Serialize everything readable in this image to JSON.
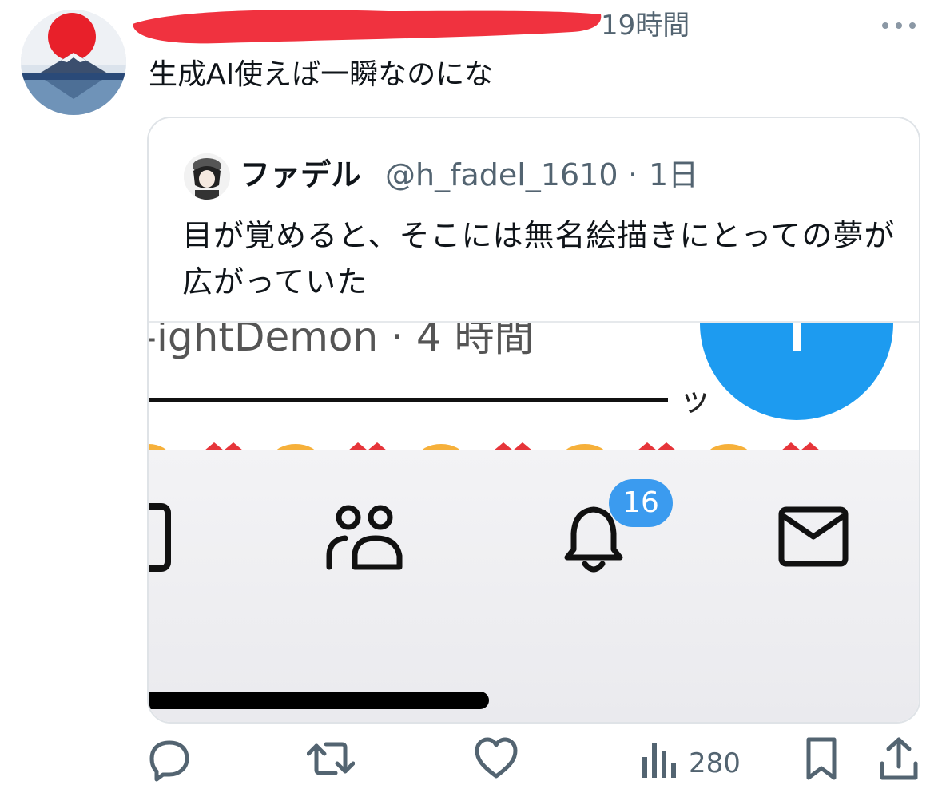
{
  "tweet": {
    "timestamp": "19時間",
    "text": "生成AI使えば一瞬なのにな",
    "more_icon": "more-dots-icon"
  },
  "quote": {
    "display_name": "ファデル",
    "handle": "@h_fadel_1610",
    "separator": "·",
    "time": "1日",
    "text": "目が覚めると、そこには無名絵描きにとっての夢が広がっていた",
    "screenshot": {
      "partial_name": "-ightDemon · 4 時間",
      "tail_char": "ッ",
      "notification_badge": "16",
      "accent_color": "#1d9bf0"
    }
  },
  "actions": {
    "reply_icon": "reply-icon",
    "retweet_icon": "retweet-icon",
    "like_icon": "heart-icon",
    "views_icon": "views-icon",
    "views_count": "280",
    "bookmark_icon": "bookmark-icon",
    "share_icon": "share-icon"
  }
}
